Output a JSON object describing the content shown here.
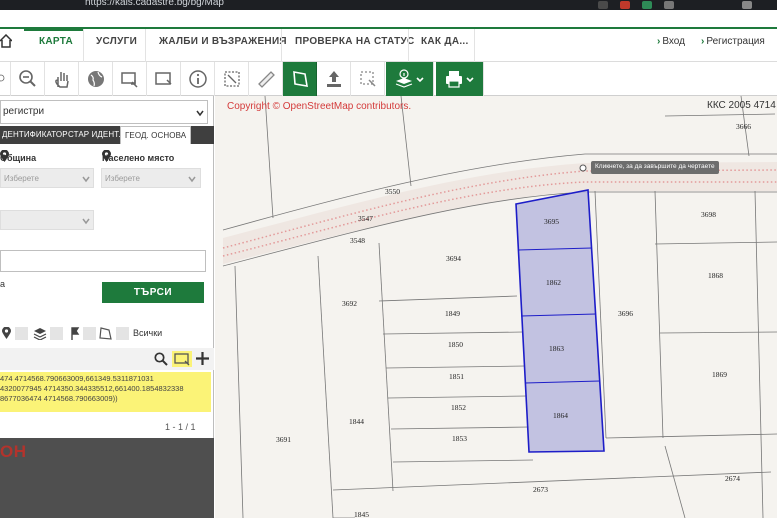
{
  "browser": {
    "url": "https://kais.cadastre.bg/bg/Map"
  },
  "nav": {
    "tabs": [
      "КАРТА",
      "УСЛУГИ",
      "ЖАЛБИ И ВЪЗРАЖЕНИЯ",
      "ПРОВЕРКА НА СТАТУС",
      "КАК ДА..."
    ],
    "login": "Вход",
    "register": "Регистрация"
  },
  "panel": {
    "registry_select": "регистри",
    "tabs": [
      "ДЕНТИФИКАТОР",
      "СТАР ИДЕНТ.",
      "ГЕОД. ОСНОВА"
    ],
    "municipality_label": "Община",
    "settlement_label": "Населено място",
    "municipality_placeholder": "Изберете",
    "settlement_placeholder": "Изберете",
    "search_button": "ТЪРСИ",
    "letter_a": "а",
    "filter_all": "Всички",
    "result_lines": [
      "474 4714568.790663009,661349.5311871031",
      "4320077945 4714350.344335512,661400.1854832338",
      "8677036474 4714568.790663009))"
    ],
    "pager": "1 - 1 / 1",
    "red_text": "ОН"
  },
  "map": {
    "copyright": "Copyright © OpenStreetMap contributors.",
    "crs": "ККС 2005 4714",
    "tooltip": "Кликнете, за да завършите да чертаете",
    "parcels": {
      "p3666": "3666",
      "p3550": "3550",
      "p3547": "3547",
      "p3548": "3548",
      "p3695": "3695",
      "p3698": "3698",
      "p3694": "3694",
      "p1862": "1862",
      "p1868": "1868",
      "p3692": "3692",
      "p1849": "1849",
      "p3696": "3696",
      "p1850": "1850",
      "p1863": "1863",
      "p1851": "1851",
      "p1869": "1869",
      "p1852": "1852",
      "p1864": "1864",
      "p1844": "1844",
      "p3691": "3691",
      "p1853": "1853",
      "p2673": "2673",
      "p2674": "2674",
      "p1845": "1845"
    }
  },
  "colors": {
    "brand_green": "#1e7a3c",
    "highlight_fill": "#b9b9de",
    "highlight_stroke": "#1d1dc8"
  }
}
